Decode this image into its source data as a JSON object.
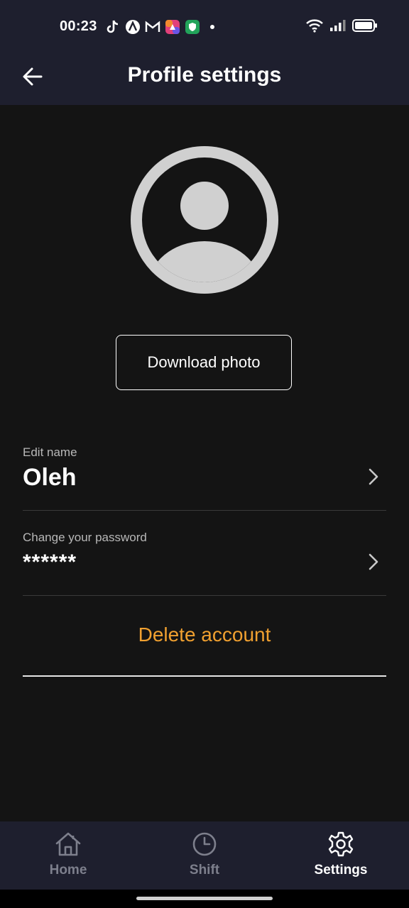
{
  "status_bar": {
    "time": "00:23",
    "left_icons": [
      "tiktok-icon",
      "app-a-icon",
      "gmail-icon",
      "photo-app-icon",
      "shield-app-icon",
      "dot-icon"
    ],
    "right_icons": [
      "wifi-icon",
      "signal-icon",
      "battery-icon"
    ]
  },
  "header": {
    "title": "Profile settings",
    "back_icon": "arrow-left-icon"
  },
  "profile": {
    "avatar_icon": "user-avatar-icon",
    "download_photo_label": "Download photo"
  },
  "fields": [
    {
      "label": "Edit name",
      "value": "Oleh"
    },
    {
      "label": "Change your password",
      "value": "******"
    }
  ],
  "actions": {
    "delete_account_label": "Delete account"
  },
  "bottom_nav": {
    "items": [
      {
        "label": "Home",
        "icon": "home-icon",
        "active": false
      },
      {
        "label": "Shift",
        "icon": "clock-icon",
        "active": false
      },
      {
        "label": "Settings",
        "icon": "gear-icon",
        "active": true
      }
    ]
  },
  "colors": {
    "background": "#141414",
    "bar_background": "#1e1f2e",
    "accent": "#f0a030",
    "inactive_nav": "#7d7f8c",
    "text": "#ffffff"
  }
}
